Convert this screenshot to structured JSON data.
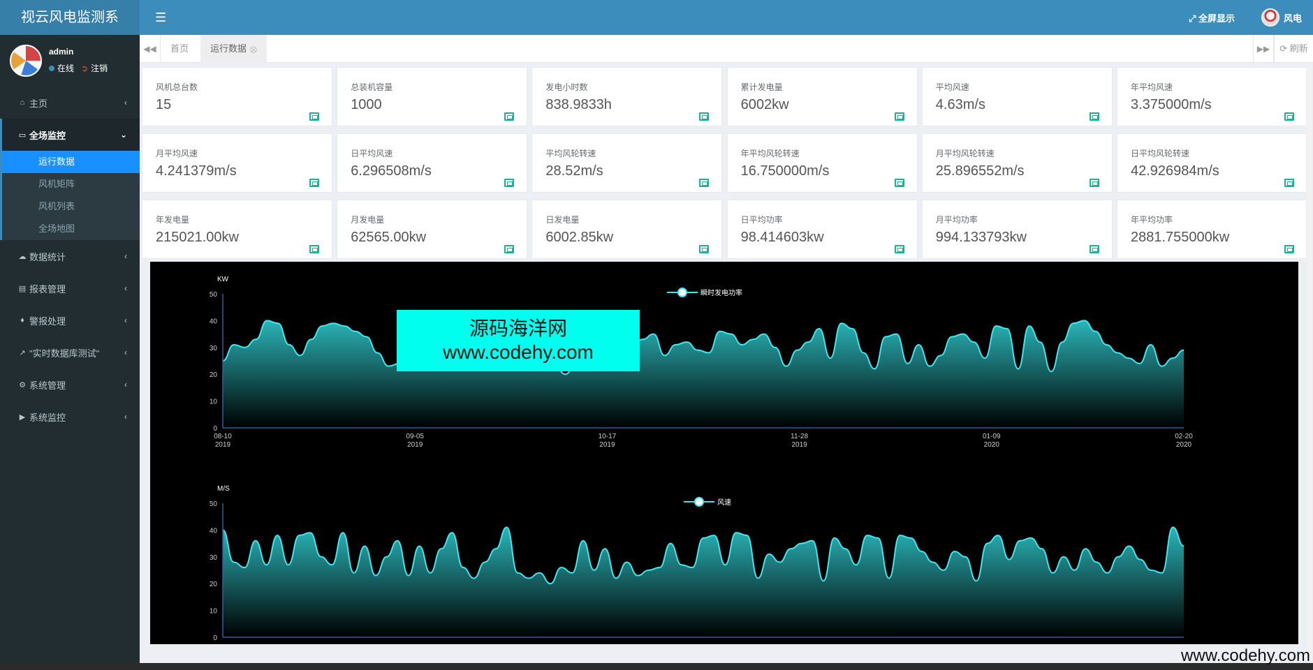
{
  "app": {
    "logo": "视云风电监测系",
    "fullscreen_label": "全屏显示",
    "user_label": "风电"
  },
  "user_panel": {
    "name": "admin",
    "online": "在线",
    "logout": "注销"
  },
  "sidebar": {
    "items": [
      {
        "label": "主页",
        "icon": "home-icon"
      },
      {
        "label": "全场监控",
        "icon": "monitor-icon"
      },
      {
        "label": "数据统计",
        "icon": "cloud-icon"
      },
      {
        "label": "报表管理",
        "icon": "file-icon"
      },
      {
        "label": "警报处理",
        "icon": "bell-icon"
      },
      {
        "label": "\"实时数据库测试\"",
        "icon": "line-chart-icon"
      },
      {
        "label": "系统管理",
        "icon": "gear-icon"
      },
      {
        "label": "系统监控",
        "icon": "video-icon"
      }
    ],
    "submenu": [
      "运行数据",
      "风机矩阵",
      "风机列表",
      "全场地图"
    ]
  },
  "tabs": {
    "home": "首页",
    "current": "运行数据",
    "refresh": "刷新"
  },
  "stats": [
    {
      "title": "风机总台数",
      "value": "15"
    },
    {
      "title": "总装机容量",
      "value": "1000"
    },
    {
      "title": "发电小时数",
      "value": "838.9833h"
    },
    {
      "title": "累计发电量",
      "value": "6002kw"
    },
    {
      "title": "平均风速",
      "value": "4.63m/s"
    },
    {
      "title": "年平均风速",
      "value": "3.375000m/s"
    },
    {
      "title": "月平均风速",
      "value": "4.241379m/s"
    },
    {
      "title": "日平均风速",
      "value": "6.296508m/s"
    },
    {
      "title": "平均风轮转速",
      "value": "28.52m/s"
    },
    {
      "title": "年平均风轮转速",
      "value": "16.750000m/s"
    },
    {
      "title": "月平均风轮转速",
      "value": "25.896552m/s"
    },
    {
      "title": "日平均风轮转速",
      "value": "42.926984m/s"
    },
    {
      "title": "年发电量",
      "value": "215021.00kw"
    },
    {
      "title": "月发电量",
      "value": "62565.00kw"
    },
    {
      "title": "日发电量",
      "value": "6002.85kw"
    },
    {
      "title": "日平均功率",
      "value": "98.414603kw"
    },
    {
      "title": "月平均功率",
      "value": "994.133793kw"
    },
    {
      "title": "年平均功率",
      "value": "2881.755000kw"
    }
  ],
  "watermark": {
    "line1": "源码海洋网",
    "line2": "www.codehy.com",
    "bottom": "www.codehy.com"
  },
  "colors": {
    "header": "#3c8dbc",
    "sidebar": "#222d32",
    "accent": "#1890ff",
    "series": "#3ee8ee"
  },
  "chart_data": [
    {
      "type": "area",
      "ylabel": "KW",
      "legend": "瞬时发电功率",
      "legend_position": "top-center",
      "ylim": [
        0,
        50
      ],
      "yticks": [
        0,
        10,
        20,
        30,
        40,
        50
      ],
      "xticks": [
        [
          "08-10",
          "2019"
        ],
        [
          "09-05",
          "2019"
        ],
        [
          "10-17",
          "2019"
        ],
        [
          "11-28",
          "2019"
        ],
        [
          "01-09",
          "2020"
        ],
        [
          "02-20",
          "2020"
        ]
      ],
      "series": [
        {
          "name": "瞬时发电功率",
          "values": [
            25,
            31,
            30,
            33,
            40,
            39,
            31,
            27,
            33,
            38,
            39,
            38,
            36,
            34,
            28,
            23,
            24,
            30,
            33,
            40,
            31,
            34,
            30,
            28,
            27,
            30,
            33,
            36,
            31,
            26,
            24,
            20,
            24,
            29,
            34,
            30,
            26,
            29,
            33,
            35,
            27,
            31,
            32,
            29,
            28,
            36,
            35,
            31,
            33,
            35,
            30,
            23,
            29,
            32,
            37,
            26,
            39,
            37,
            28,
            22,
            34,
            35,
            24,
            31,
            23,
            27,
            34,
            35,
            32,
            26,
            38,
            37,
            22,
            38,
            32,
            21,
            32,
            39,
            40,
            36,
            31,
            28,
            26,
            24,
            31,
            23,
            26,
            29
          ]
        }
      ]
    },
    {
      "type": "area",
      "ylabel": "M/S",
      "legend": "风速",
      "legend_position": "top-center",
      "ylim": [
        0,
        50
      ],
      "yticks": [
        0,
        10,
        20,
        30,
        40,
        50
      ],
      "xticks": [],
      "series": [
        {
          "name": "风速",
          "values": [
            40,
            28,
            26,
            36,
            27,
            38,
            27,
            38,
            39,
            30,
            27,
            39,
            24,
            34,
            23,
            30,
            36,
            23,
            34,
            24,
            33,
            39,
            26,
            22,
            28,
            33,
            41,
            24,
            22,
            24,
            20,
            26,
            24,
            36,
            25,
            33,
            22,
            28,
            23,
            25,
            26,
            35,
            27,
            26,
            37,
            38,
            27,
            39,
            38,
            22,
            31,
            28,
            33,
            35,
            36,
            21,
            37,
            33,
            27,
            38,
            37,
            22,
            38,
            37,
            32,
            28,
            25,
            32,
            30,
            21,
            35,
            38,
            29,
            36,
            37,
            33,
            24,
            30,
            25,
            33,
            28,
            24,
            30,
            34,
            29,
            25,
            24,
            41,
            34
          ]
        }
      ]
    }
  ]
}
